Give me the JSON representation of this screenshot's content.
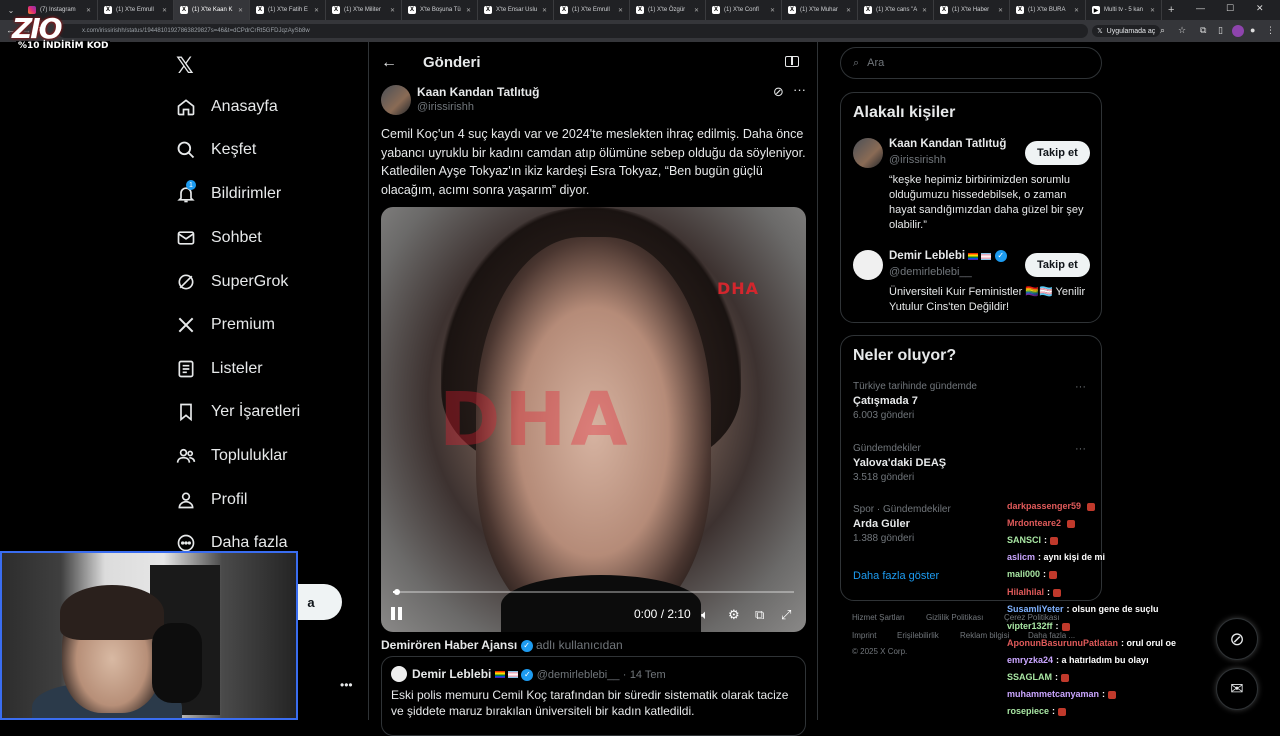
{
  "browser": {
    "tabs": [
      {
        "label": "(7) Instagram",
        "icon": "instagram-icon"
      },
      {
        "label": "(1) X'te Emrull",
        "icon": "x-icon"
      },
      {
        "label": "(1) X'te Kaan K",
        "icon": "x-icon",
        "active": true
      },
      {
        "label": "(1) X'te Fatih E",
        "icon": "x-icon"
      },
      {
        "label": "(1) X'te Militer",
        "icon": "x-icon"
      },
      {
        "label": "X'te Boşuna Tü",
        "icon": "x-icon"
      },
      {
        "label": "X'te Ensar Uslu",
        "icon": "x-icon"
      },
      {
        "label": "(1) X'te Emrull",
        "icon": "x-icon"
      },
      {
        "label": "(1) X'te Özgür",
        "icon": "x-icon"
      },
      {
        "label": "(1) X'te Confl",
        "icon": "x-icon"
      },
      {
        "label": "(1) X'te Muhar",
        "icon": "x-icon"
      },
      {
        "label": "(1) X'te cans \"A",
        "icon": "x-icon"
      },
      {
        "label": "(1) X'te Haber",
        "icon": "x-icon"
      },
      {
        "label": "(1) X'te BURA",
        "icon": "x-icon"
      },
      {
        "label": "Multi tv - 5 kan",
        "icon": "tv-icon"
      }
    ],
    "url": "x.com/irissirishh/status/19448101927863829827s=46&t=dCPdrCrRt5GFDJqzAySb8w",
    "app_chip": "Uygulamada aç"
  },
  "overlay": {
    "logo": "ZIO",
    "promo": "%10 İNDİRİM KOD"
  },
  "nav": {
    "items": [
      {
        "label": "Anasayfa",
        "icon": "home-icon"
      },
      {
        "label": "Keşfet",
        "icon": "search-icon"
      },
      {
        "label": "Bildirimler",
        "icon": "bell-icon",
        "badge": "1"
      },
      {
        "label": "Sohbet",
        "icon": "mail-icon"
      },
      {
        "label": "SuperGrok",
        "icon": "grok-icon"
      },
      {
        "label": "Premium",
        "icon": "x-icon"
      },
      {
        "label": "Listeler",
        "icon": "list-icon"
      },
      {
        "label": "Yer İşaretleri",
        "icon": "bookmark-icon"
      },
      {
        "label": "Topluluklar",
        "icon": "people-icon"
      },
      {
        "label": "Profil",
        "icon": "person-icon"
      },
      {
        "label": "Daha fazla",
        "icon": "more-circle-icon"
      }
    ],
    "post_button": "a"
  },
  "post": {
    "header": "Gönderi",
    "author_name": "Kaan Kandan Tatlıtuğ",
    "author_handle": "@irissirishh",
    "text": "Cemil Koç'un 4 suç kaydı var ve 2024'te meslekten ihraç edilmiş. Daha önce yabancı uyruklu bir kadını camdan atıp ölümüne sebep olduğu da söyleniyor. Katledilen Ayşe Tokyaz'ın ikiz kardeşi Esra Tokyaz, “Ben bugün güçlü olacağım, acımı sonra yaşarım” diyor.",
    "video": {
      "watermark": "DHA",
      "time": "0:00 / 2:10",
      "progress": 0.01
    },
    "source": {
      "name": "Demirören Haber Ajansı",
      "suffix": "adlı kullanıcıdan"
    },
    "quote": {
      "author_name": "Demir Leblebi",
      "author_handle": "@demirleblebi__",
      "date": "14 Tem",
      "text": "Eski polis memuru Cemil Koç tarafından bir süredir sistematik olarak tacize ve şiddete maruz bırakılan üniversiteli bir kadın katledildi."
    }
  },
  "sidebar": {
    "search_placeholder": "Ara",
    "related": {
      "title": "Alakalı kişiler",
      "people": [
        {
          "name": "Kaan Kandan Tatlıtuğ",
          "handle": "@irissirishh",
          "bio": "“keşke hepimiz birbirimizden sorumlu olduğumuzu hissedebilsek, o zaman hayat sandığımızdan daha güzel bir şey olabilir.”",
          "follow": "Takip et"
        },
        {
          "name": "Demir Leblebi",
          "handle": "@demirleblebi__",
          "bio": "Üniversiteli Kuir Feministler 🏳️‍🌈🏳️‍⚧️ Yenilir Yutulur Cins'ten Değildir!",
          "follow": "Takip et"
        }
      ]
    },
    "trends": {
      "title": "Neler oluyor?",
      "items": [
        {
          "context": "Türkiye tarihinde gündemde",
          "title": "Çatışmada 7",
          "count": "6.003 gönderi"
        },
        {
          "context": "Gündemdekiler",
          "title": "Yalova'daki DEAŞ",
          "count": "3.518 gönderi"
        },
        {
          "context": "Spor · Gündemdekiler",
          "title": "Arda Güler",
          "count": "1.388 gönderi"
        }
      ],
      "show_more": "Daha fazla göster"
    },
    "footer": {
      "links": [
        "Hizmet Şartları",
        "Gizlilik Politikası",
        "Çerez Politikası",
        "Imprint",
        "Erişilebilirlik",
        "Reklam bilgisi",
        "Daha fazla ..."
      ],
      "copyright": "© 2025 X Corp."
    }
  },
  "chat": [
    {
      "user": "darkpassenger59",
      "msg": ""
    },
    {
      "user": "Mrdonteare2",
      "msg": ""
    },
    {
      "user": "SANSCI",
      "msg": ":"
    },
    {
      "user": "aslicm",
      "msg": ": aynı kişi de mi"
    },
    {
      "user": "mali000",
      "msg": ":"
    },
    {
      "user": "Hilalhilal",
      "msg": ":"
    },
    {
      "user": "SusamliYeter",
      "msg": ": olsun gene de suçlu"
    },
    {
      "user": "vipter132ff",
      "msg": ":"
    },
    {
      "user": "AponunBasurunuPatlatan",
      "msg": ": orul orul oe"
    },
    {
      "user": "emryzka24",
      "msg": ": a hatırladım bu olayı"
    },
    {
      "user": "SSAGLAM",
      "msg": ":"
    },
    {
      "user": "muhammetcanyaman",
      "msg": ":"
    },
    {
      "user": "rosepiece",
      "msg": ":"
    }
  ]
}
